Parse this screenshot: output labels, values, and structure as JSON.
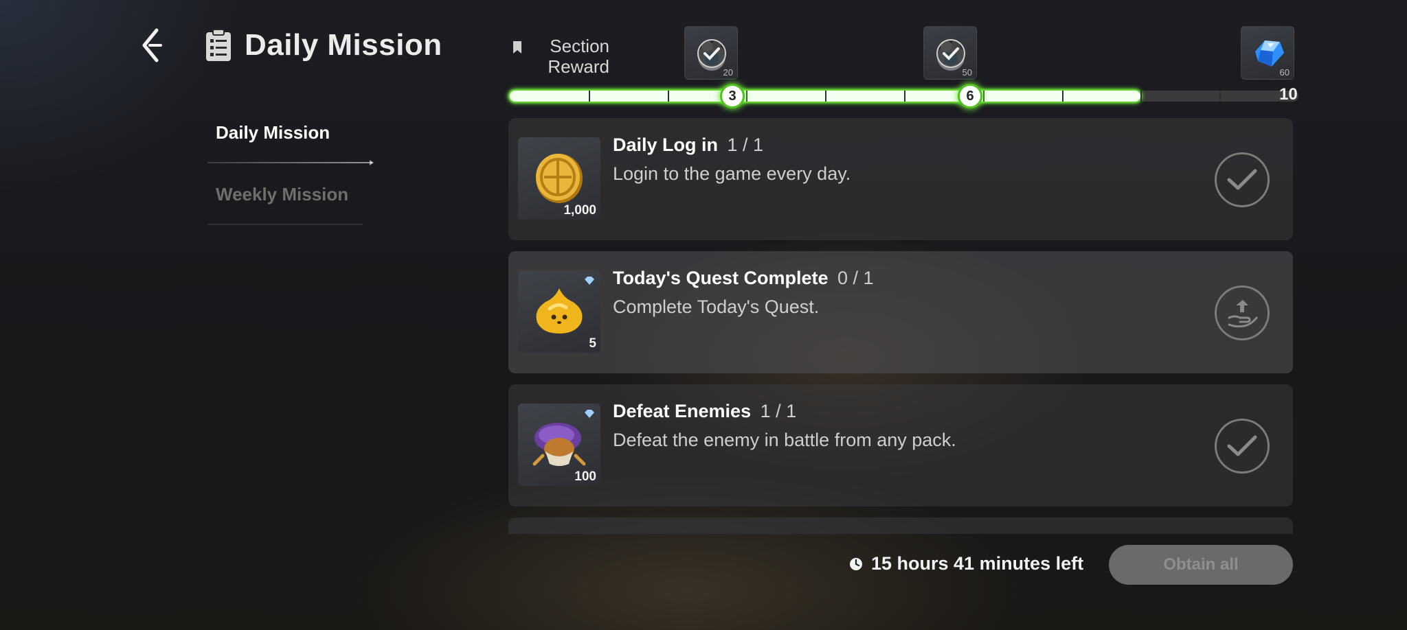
{
  "header": {
    "title": "Daily Mission"
  },
  "sidebar": {
    "tabs": [
      {
        "label": "Daily Mission",
        "active": true
      },
      {
        "label": "Weekly Mission",
        "active": false
      }
    ]
  },
  "section_reward": {
    "label_line1": "Section",
    "label_line2": "Reward",
    "current": 8,
    "max": 10,
    "milestones": [
      {
        "point": "3",
        "reward_count": "20",
        "claimed": true
      },
      {
        "point": "6",
        "reward_count": "50",
        "claimed": true
      },
      {
        "point": "10",
        "reward_count": "60",
        "claimed": false,
        "icon": "blue-gem-icon"
      }
    ]
  },
  "missions": [
    {
      "name": "Daily Log in",
      "progress": "1 / 1",
      "description": "Login to the game every day.",
      "reward_count": "1,000",
      "reward_icon": "gold-coin-icon",
      "status": "completed"
    },
    {
      "name": "Today's Quest Complete",
      "progress": "0 / 1",
      "description": "Complete Today's Quest.",
      "reward_count": "5",
      "reward_icon": "yellow-slime-icon",
      "status": "in-progress"
    },
    {
      "name": "Defeat Enemies",
      "progress": "1 / 1",
      "description": "Defeat the enemy in battle from any pack.",
      "reward_count": "100",
      "reward_icon": "mushroom-character-icon",
      "status": "completed"
    }
  ],
  "footer": {
    "time_left": "15 hours 41 minutes left",
    "obtain_all_label": "Obtain all"
  },
  "colors": {
    "progress_glow": "#54d222",
    "background": "#18181b",
    "card": "#3a3a3c"
  }
}
